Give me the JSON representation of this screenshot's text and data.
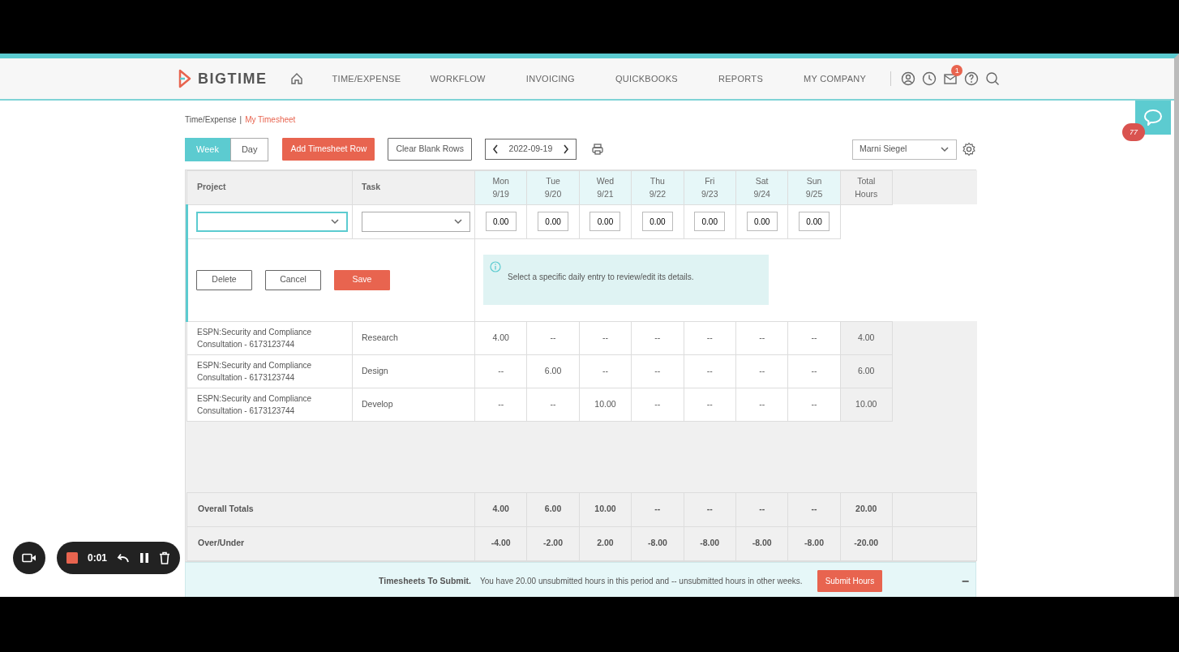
{
  "nav": {
    "logo": "BIGTIME",
    "items": [
      {
        "label": "TIME/EXPENSE"
      },
      {
        "label": "WORKFLOW"
      },
      {
        "label": "INVOICING"
      },
      {
        "label": "QUICKBOOKS"
      },
      {
        "label": "REPORTS"
      },
      {
        "label": "MY COMPANY"
      }
    ],
    "mail_badge": "1"
  },
  "breadcrumb_separator": "|",
  "breadcrumb": [
    {
      "label": "Time/Expense",
      "current": false
    },
    {
      "label": "My Timesheet",
      "current": true
    }
  ],
  "toolbar": {
    "view_toggle": [
      {
        "label": "Week",
        "selected": true
      },
      {
        "label": "Day",
        "selected": false
      }
    ],
    "add_button": "Add Timesheet Row",
    "clear_button": "Clear Blank Rows",
    "date": "2022-09-19",
    "user": "Marni Siegel"
  },
  "table": {
    "columns": {
      "project": "Project",
      "task": "Task",
      "total": [
        "Total",
        "Hours"
      ],
      "days": [
        {
          "day": "Mon",
          "date": "9/19"
        },
        {
          "day": "Tue",
          "date": "9/20"
        },
        {
          "day": "Wed",
          "date": "9/21"
        },
        {
          "day": "Thu",
          "date": "9/22"
        },
        {
          "day": "Fri",
          "date": "9/23"
        },
        {
          "day": "Sat",
          "date": "9/24"
        },
        {
          "day": "Sun",
          "date": "9/25"
        }
      ]
    },
    "edit_row": {
      "day_values": [
        "0.00",
        "0.00",
        "0.00",
        "0.00",
        "0.00",
        "0.00",
        "0.00"
      ],
      "buttons": [
        {
          "label": "Delete",
          "kind": "outline"
        },
        {
          "label": "Cancel",
          "kind": "outline"
        },
        {
          "label": "Save",
          "kind": "primary"
        }
      ],
      "info": "Select a specific daily entry to review/edit its details."
    },
    "rows": [
      {
        "project": [
          "ESPN:Security and Compliance",
          "Consultation - 6173123744"
        ],
        "task": "Research",
        "values": [
          "4.00",
          "--",
          "--",
          "--",
          "--",
          "--",
          "--"
        ],
        "total": "4.00"
      },
      {
        "project": [
          "ESPN:Security and Compliance",
          "Consultation - 6173123744"
        ],
        "task": "Design",
        "values": [
          "--",
          "6.00",
          "--",
          "--",
          "--",
          "--",
          "--"
        ],
        "total": "6.00"
      },
      {
        "project": [
          "ESPN:Security and Compliance",
          "Consultation - 6173123744"
        ],
        "task": "Develop",
        "values": [
          "--",
          "--",
          "10.00",
          "--",
          "--",
          "--",
          "--"
        ],
        "total": "10.00"
      }
    ],
    "summary": [
      {
        "label": "Overall Totals",
        "values": [
          "4.00",
          "6.00",
          "10.00",
          "--",
          "--",
          "--",
          "--"
        ],
        "total": "20.00"
      },
      {
        "label": "Over/Under",
        "values": [
          "-4.00",
          "-2.00",
          "2.00",
          "-8.00",
          "-8.00",
          "-8.00",
          "-8.00"
        ],
        "total": "-20.00"
      }
    ]
  },
  "submit_bar": {
    "title": "Timesheets To Submit.",
    "message": "You have 20.00 unsubmitted hours in this period and -- unsubmitted hours in other weeks.",
    "button": "Submit Hours",
    "toggle": "−"
  },
  "chat": {
    "badge": "77"
  },
  "recorder": {
    "time": "0:01"
  }
}
